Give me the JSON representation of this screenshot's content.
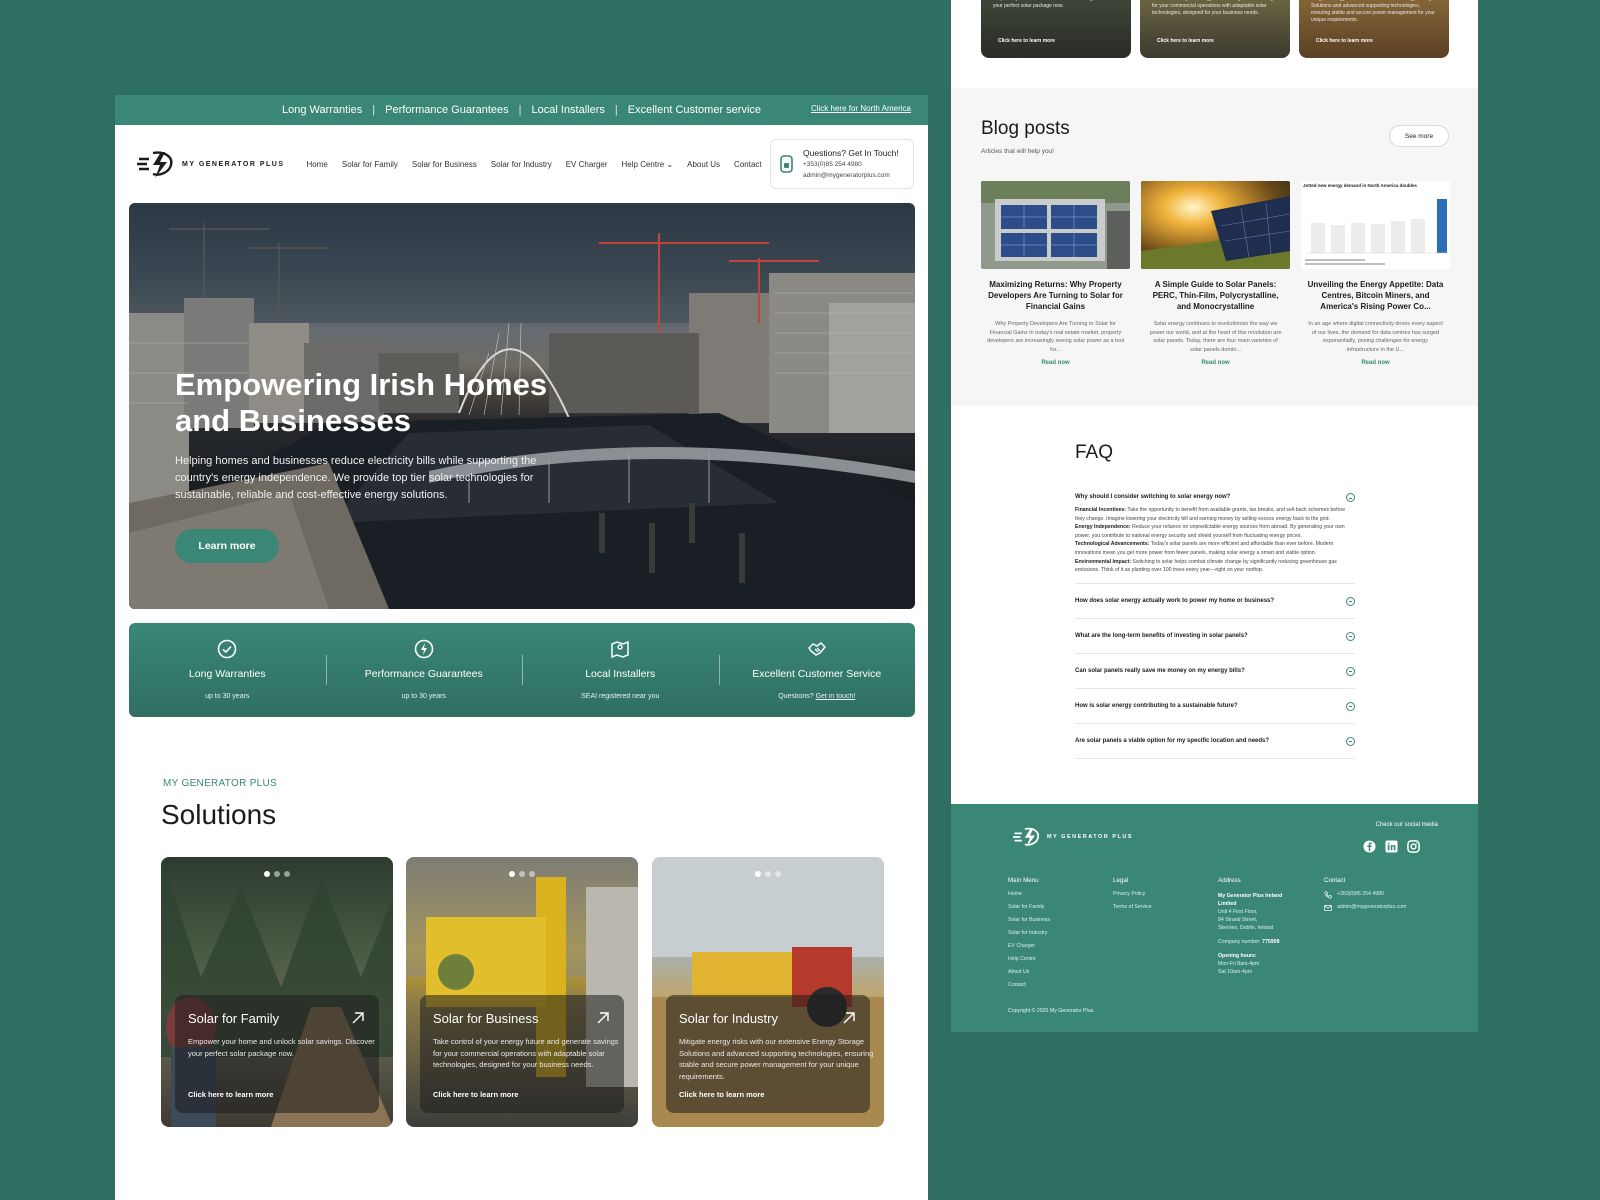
{
  "topbar": {
    "items": [
      "Long Warranties",
      "Performance Guarantees",
      "Local Installers",
      "Excellent Customer service"
    ],
    "na_link": "Click here for North America"
  },
  "brand": {
    "name": "MY GENERATOR PLUS"
  },
  "nav": [
    "Home",
    "Solar for Family",
    "Solar for Business",
    "Solar for Industry",
    "EV Charger",
    "Help Centre",
    "About Us",
    "Contact"
  ],
  "contact_box": {
    "title": "Questions? Get In Touch!",
    "phone": "+353(0)85 254 4980",
    "email": "admin@mygeneratorplus.com"
  },
  "hero": {
    "title": "Empowering Irish Homes and Businesses",
    "description": "Helping homes and businesses reduce electricity bills while supporting the country's energy independence. We provide top tier solar technologies for sustainable, reliable and cost-effective energy solutions.",
    "button": "Learn more"
  },
  "features": [
    {
      "title": "Long Warranties",
      "sub": "up to 30 years",
      "icon": "check-circle-icon"
    },
    {
      "title": "Performance Guarantees",
      "sub": "up to 30 years",
      "icon": "lightning-icon"
    },
    {
      "title": "Local Installers",
      "sub": "SEAI registered near you",
      "icon": "map-pin-icon"
    },
    {
      "title": "Excellent Customer Service",
      "sub": "Questions?",
      "sub_link": "Get in touch!",
      "icon": "handshake-icon"
    }
  ],
  "solutions": {
    "eyebrow": "MY GENERATOR PLUS",
    "title": "Solutions",
    "cards": [
      {
        "title": "Solar for Family",
        "desc": "Empower your home and unlock solar savings. Discover your perfect solar package now.",
        "link": "Click here to learn more"
      },
      {
        "title": "Solar for Business",
        "desc": "Take control of your energy future and generate savings for your commercial operations with adaptable solar technologies, designed for your business needs.",
        "link": "Click here to learn more"
      },
      {
        "title": "Solar for Industry",
        "desc": "Mitigate energy risks with our extensive Energy Storage Solutions and advanced supporting technologies, ensuring stable and secure power management for your unique requirements.",
        "link": "Click here to learn more"
      }
    ]
  },
  "top_cards": [
    {
      "text": "Empower your home and unlock solar savings. Discover your perfect solar package now.",
      "link": "Click here to learn more"
    },
    {
      "text": "Take control of your energy future and generate savings for your commercial operations with adaptable solar technologies, designed for your business needs.",
      "link": "Click here to learn more"
    },
    {
      "text": "Mitigate energy risks with our extensive Energy Storage Solutions and advanced supporting technologies, ensuring stable and secure power management for your unique requirements.",
      "link": "Click here to learn more"
    }
  ],
  "blog": {
    "title": "Blog posts",
    "subtitle": "Articles that will help you!",
    "see_more": "See more",
    "posts": [
      {
        "title": "Maximizing Returns: Why Property Developers Are Turning to Solar for Financial Gains",
        "excerpt": "Why Property Developers Are Turning to Solar for Financial Gains In today's real estate market, property developers are increasingly seeing solar power as a tool for...",
        "link": "Read now"
      },
      {
        "title": "A Simple Guide to Solar Panels: PERC, Thin-Film, Polycrystalline, and Monocrystalline",
        "excerpt": "Solar energy continues to revolutionize the way we power our world, and at the heart of this revolution are solar panels. Today, there are four main varieties of solar panels domin...",
        "link": "Read now"
      },
      {
        "title": "Unveiling the Energy Appetite: Data Centres, Bitcoin Miners, and America's Rising Power Co...",
        "excerpt": "In an age where digital connectivity drives every aspect of our lives, the demand for data centres has surged exponentially, posing challenges for energy infrastructure in the U...",
        "link": "Read now",
        "img_caption": "Jotted new energy demand in North America doubles"
      }
    ]
  },
  "faq": {
    "title": "FAQ",
    "items": [
      {
        "q": "Why should I consider switching to solar energy now?",
        "open": true,
        "answer": [
          {
            "label": "Financial Incentives:",
            "text": "Take the opportunity to benefit from available grants, tax breaks, and sell-back schemes before they change. Imagine lowering your electricity bill and earning money by selling excess energy back to the grid."
          },
          {
            "label": "Energy Independence:",
            "text": "Reduce your reliance on unpredictable energy sources from abroad. By generating your own power, you contribute to national energy security and shield yourself from fluctuating energy prices."
          },
          {
            "label": "Technological Advancements:",
            "text": "Today's solar panels are more efficient and affordable than ever before. Modern innovations mean you get more power from fewer panels, making solar energy a smart and viable option."
          },
          {
            "label": "Environmental Impact:",
            "text": "Switching to solar helps combat climate change by significantly reducing greenhouse gas emissions. Think of it as planting over 100 trees every year—right on your rooftop."
          }
        ]
      },
      {
        "q": "How does solar energy actually work to power my home or business?",
        "open": false
      },
      {
        "q": "What are the long-term benefits of investing in solar panels?",
        "open": false
      },
      {
        "q": "Can solar panels really save me money on my energy bills?",
        "open": false
      },
      {
        "q": "How is solar energy contributing to a sustainable future?",
        "open": false
      },
      {
        "q": "Are solar panels a viable option for my specific location and needs?",
        "open": false
      }
    ]
  },
  "footer": {
    "social_title": "Check our social media",
    "main_menu": {
      "head": "Main Menu",
      "items": [
        "Home",
        "Solar for Family",
        "Solar for Business",
        "Solar for Industry",
        "EV Charger",
        "Help Centre",
        "About Us",
        "Contact"
      ]
    },
    "legal": {
      "head": "Legal",
      "items": [
        "Privacy Policy",
        "Terms of Service"
      ]
    },
    "address": {
      "head": "Address",
      "company": "My Generator Plus Ireland Limited",
      "lines": [
        "Unit 4 First Floor,",
        "84 Strand Street,",
        "Skerries, Dublin, Ireland"
      ],
      "company_number_label": "Company number:",
      "company_number": "775908",
      "hours_label": "Opening hours:",
      "hours": [
        "Mon-Fri 8am-4pm",
        "Sat 10am-4pm"
      ]
    },
    "contact": {
      "head": "Contact",
      "phone": "+353(0)85 254 4980",
      "email": "admin@mygeneratorplus.com"
    },
    "copyright": "Copyright © 2025 My Generator Plus."
  },
  "colors": {
    "brand": "#3a8776",
    "brand_dark": "#2f6f62",
    "background": "#2f6f62"
  }
}
